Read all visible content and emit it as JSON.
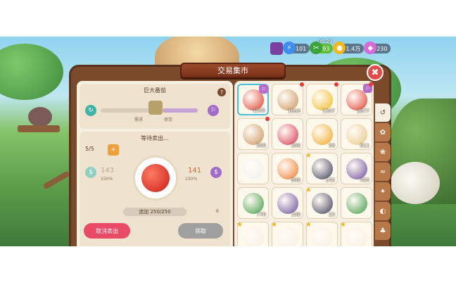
{
  "status": {
    "energy": "101",
    "time": "06:29",
    "stamina": "93",
    "coins": "1.4万",
    "gems": "230"
  },
  "dialog": {
    "title": "交易集市",
    "close_icon": "✖"
  },
  "request": {
    "item_name": "巨大番茄",
    "help_label": "?",
    "demand_label": "需求",
    "supply_label": "供货"
  },
  "sale": {
    "title": "等待卖出...",
    "slots": "5/5",
    "add_label": "+",
    "base_price": "143",
    "base_pct": "150%",
    "current_price": "141",
    "current_pct": "150%",
    "added": "追加 250/250",
    "tip_count": "0",
    "cancel_label": "取消卖出",
    "collect_label": "领取"
  },
  "inventory": [
    {
      "name": "番茄",
      "count": "1205",
      "color": "#e13b2d",
      "tag": true,
      "dot": false,
      "selected": true
    },
    {
      "name": "土豆",
      "count": "1003",
      "color": "#c99256",
      "tag": false,
      "dot": true
    },
    {
      "name": "玉米",
      "count": "1397",
      "color": "#f3b820",
      "tag": false,
      "dot": true
    },
    {
      "name": "番茄",
      "count": "2877",
      "color": "#e13b2d",
      "tag": true,
      "dot": true
    },
    {
      "name": "土豆",
      "count": "500",
      "color": "#c99256",
      "tag": false,
      "dot": true
    },
    {
      "name": "树莓",
      "count": "200",
      "color": "#d9314a",
      "tag": false,
      "dot": false
    },
    {
      "name": "菠萝",
      "count": "50",
      "color": "#f0a522",
      "tag": false,
      "dot": false
    },
    {
      "name": "小麦",
      "count": "611",
      "color": "#e7c680",
      "tag": false,
      "dot": false
    },
    {
      "name": "棉花",
      "count": "",
      "color": "#f1f1f1",
      "tag": false,
      "dot": false
    },
    {
      "name": "胡萝卜",
      "count": "900",
      "color": "#f07a2a",
      "tag": false,
      "dot": false
    },
    {
      "name": "黑莓",
      "count": "142",
      "color": "#3b3b55",
      "tag": false,
      "dot": false,
      "star": true
    },
    {
      "name": "甘蔗",
      "count": "455",
      "color": "#6b4a9a",
      "tag": false,
      "dot": false
    },
    {
      "name": "西瓜",
      "count": "770",
      "color": "#3f9a42",
      "tag": false,
      "dot": false
    },
    {
      "name": "甘蔗",
      "count": "100",
      "color": "#6b4a9a",
      "tag": false,
      "dot": false
    },
    {
      "name": "黑莓",
      "count": "23",
      "color": "#3b3b55",
      "tag": false,
      "dot": false,
      "star": true
    },
    {
      "name": "西瓜",
      "count": "",
      "color": "#3f9a42",
      "tag": false,
      "dot": false
    },
    {
      "name": "",
      "count": "",
      "color": "#f7efe2",
      "tag": false,
      "dot": false,
      "star": true
    },
    {
      "name": "",
      "count": "",
      "color": "#f7efe2",
      "tag": false,
      "dot": false,
      "star": true
    },
    {
      "name": "",
      "count": "",
      "color": "#f7efe2",
      "tag": false,
      "dot": false,
      "star": true
    },
    {
      "name": "",
      "count": "",
      "color": "#f7efe2",
      "tag": false,
      "dot": false,
      "star": true
    }
  ],
  "tabs": [
    "history-icon",
    "crop-icon",
    "flower-icon",
    "fish-icon",
    "bug-icon",
    "shell-icon",
    "mushroom-icon"
  ]
}
